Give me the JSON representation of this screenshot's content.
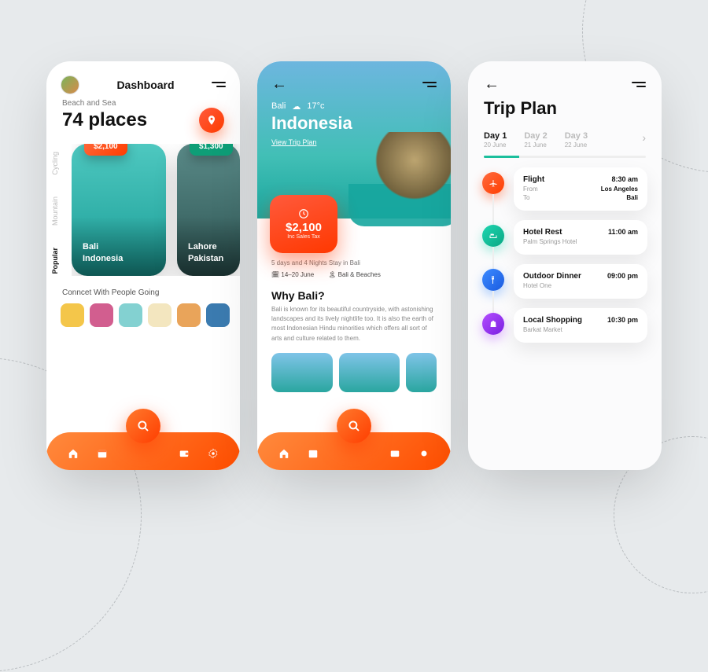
{
  "screen1": {
    "title": "Dashboard",
    "category": "Beach and Sea",
    "count_label": "74 places",
    "tabs": [
      "Cycling",
      "Mountain",
      "Popular"
    ],
    "cards": [
      {
        "price": "$2,100",
        "title": "Bali",
        "subtitle": "Indonesia"
      },
      {
        "price": "$1,300",
        "title": "Lahore",
        "subtitle": "Pakistan"
      }
    ],
    "connect_label": "Conncet With People Going",
    "people_colors": [
      "#f4c64a",
      "#d25e8f",
      "#83d1d1",
      "#f3e6bf",
      "#e9a45a",
      "#3b7bb0"
    ]
  },
  "screen2": {
    "location": "Bali",
    "weather_temp": "17°c",
    "country": "Indonesia",
    "link": "View Trip Plan",
    "price": "$2,100",
    "price_sub": "Inc Sales Tax",
    "stay": "5 days and 4 Nights Stay in Bali",
    "dates": "14–20 June",
    "tag": "Bali & Beaches",
    "section": "Why Bali?",
    "desc": "Bali is known for its beautiful countryside, with astonishing landscapes and its lively nightlife too. It is also the earth of most Indonesian Hindu minorities which offers all sort of arts and culture related to them."
  },
  "screen3": {
    "title": "Trip Plan",
    "days": [
      {
        "label": "Day 1",
        "date": "20 June"
      },
      {
        "label": "Day 2",
        "date": "21 June"
      },
      {
        "label": "Day 3",
        "date": "22 June"
      }
    ],
    "items": [
      {
        "title": "Flight",
        "time": "8:30 am",
        "from_label": "From",
        "from": "Los Angeles",
        "to_label": "To",
        "to": "Bali"
      },
      {
        "title": "Hotel Rest",
        "time": "11:00 am",
        "sub": "Palm Springs Hotel"
      },
      {
        "title": "Outdoor Dinner",
        "time": "09:00 pm",
        "sub": "Hotel One"
      },
      {
        "title": "Local Shopping",
        "time": "10:30 pm",
        "sub": "Barkat Market"
      }
    ]
  }
}
